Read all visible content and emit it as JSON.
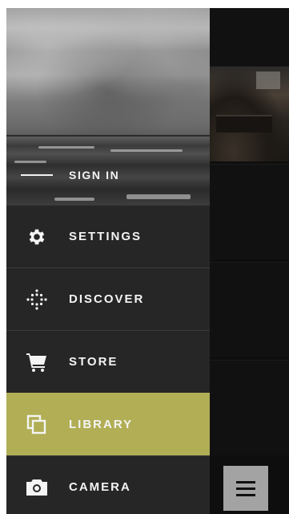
{
  "drawer": {
    "sign_in_label": "SIGN IN",
    "items": [
      {
        "id": "settings",
        "label": "SETTINGS",
        "icon": "gear-icon",
        "active": false
      },
      {
        "id": "discover",
        "label": "DISCOVER",
        "icon": "discover-dots-icon",
        "active": false
      },
      {
        "id": "store",
        "label": "STORE",
        "icon": "cart-icon",
        "active": false
      },
      {
        "id": "library",
        "label": "LIBRARY",
        "icon": "library-stack-icon",
        "active": true
      },
      {
        "id": "camera",
        "label": "CAMERA",
        "icon": "camera-icon",
        "active": false
      }
    ]
  },
  "menu_button": {
    "icon": "hamburger-icon"
  },
  "colors": {
    "drawer_bg": "#262626",
    "active_item_bg": "#b1ae55",
    "text": "#f4f4f4",
    "menu_button_bg": "#a3a3a3"
  }
}
